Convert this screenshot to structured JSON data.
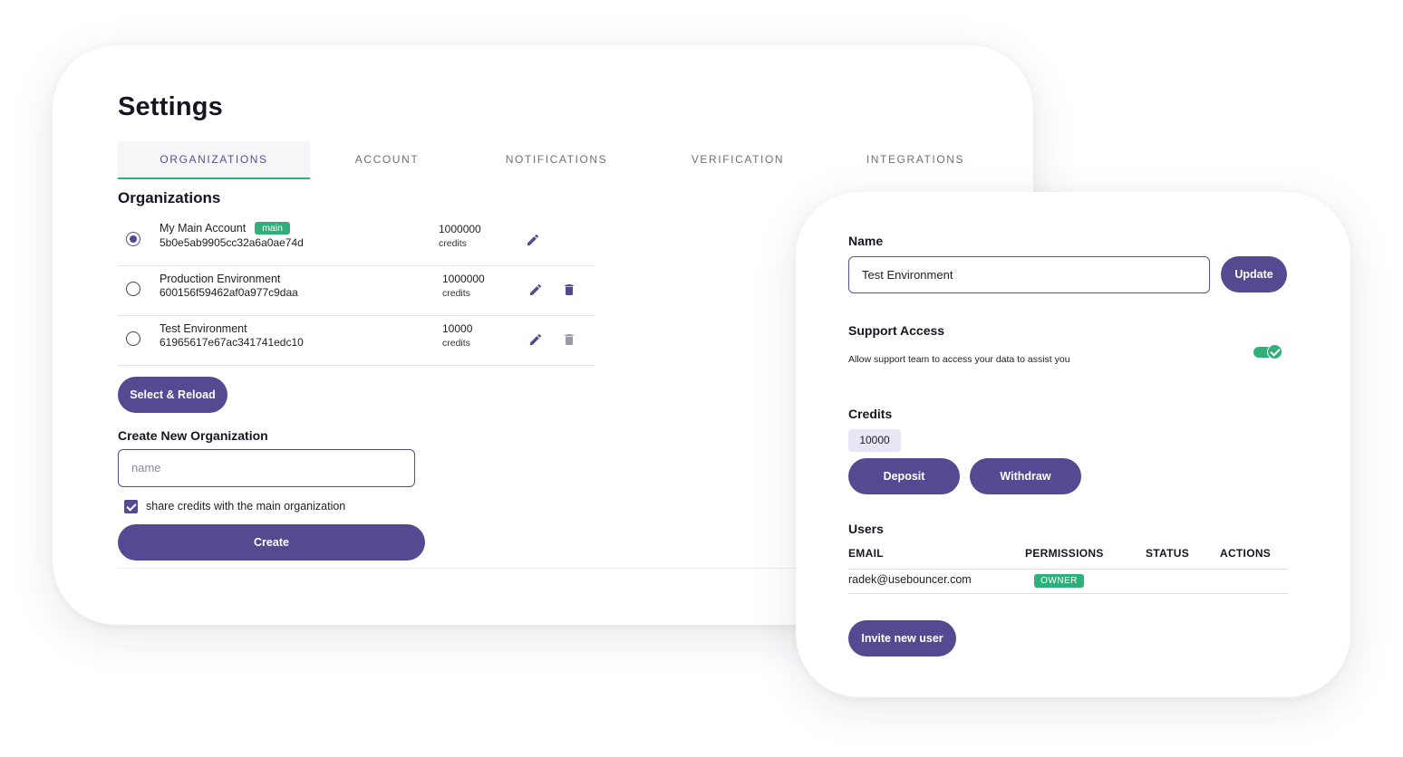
{
  "settings": {
    "title": "Settings",
    "tabs": [
      {
        "label": "ORGANIZATIONS",
        "active": true
      },
      {
        "label": "ACCOUNT",
        "active": false
      },
      {
        "label": "NOTIFICATIONS",
        "active": false
      },
      {
        "label": "VERIFICATION",
        "active": false
      },
      {
        "label": "INTEGRATIONS",
        "active": false
      }
    ],
    "organizations_title": "Organizations",
    "organizations": [
      {
        "name": "My Main Account",
        "badge": "main",
        "id": "5b0e5ab9905cc32a6a0ae74d",
        "credits": "1000000",
        "credits_label": "credits",
        "selected": true
      },
      {
        "name": "Production Environment",
        "id": "600156f59462af0a977c9daa",
        "credits": "1000000",
        "credits_label": "credits",
        "selected": false
      },
      {
        "name": "Test Environment",
        "id": "61965617e67ac341741edc10",
        "credits": "10000",
        "credits_label": "credits",
        "selected": false
      }
    ],
    "select_reload_label": "Select & Reload",
    "create_title": "Create New Organization",
    "name_placeholder": "name",
    "share_credits_label": "share credits with the main organization",
    "create_label": "Create"
  },
  "detail": {
    "name_label": "Name",
    "name_value": "Test Environment",
    "update_label": "Update",
    "support_title": "Support Access",
    "support_desc": "Allow support team to access your data to assist you",
    "support_enabled": true,
    "credits_title": "Credits",
    "credits_value": "10000",
    "deposit_label": "Deposit",
    "withdraw_label": "Withdraw",
    "users_title": "Users",
    "users_columns": [
      "EMAIL",
      "PERMISSIONS",
      "STATUS",
      "ACTIONS"
    ],
    "users": [
      {
        "email": "radek@usebouncer.com",
        "permission": "OWNER"
      }
    ],
    "invite_label": "Invite new user"
  },
  "colors": {
    "accent": "#554a92",
    "success": "#2fb07a",
    "credit_chip": "#e7e5f6"
  },
  "icons": {
    "edit": "pencil-icon",
    "delete": "trash-icon",
    "check": "check-icon"
  }
}
